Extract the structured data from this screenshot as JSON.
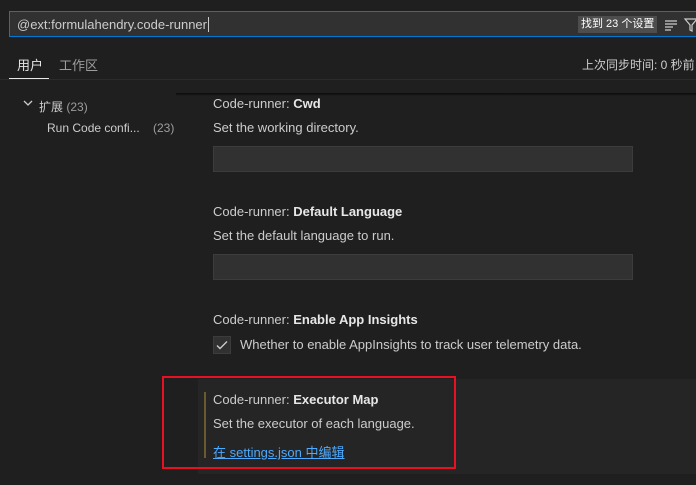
{
  "search": {
    "query": "@ext:formulahendry.code-runner",
    "found_badge": "找到 23 个设置"
  },
  "tabs": {
    "user": "用户",
    "workspace": "工作区",
    "sync_status": "上次同步时间: 0 秒前"
  },
  "toc": {
    "group_label": "扩展",
    "group_count": "(23)",
    "item_label": "Run Code confi...",
    "item_count": "(23)"
  },
  "settings": [
    {
      "category": "Code-runner: ",
      "name": "Cwd",
      "description": "Set the working directory.",
      "value": ""
    },
    {
      "category": "Code-runner: ",
      "name": "Default Language",
      "description": "Set the default language to run.",
      "value": ""
    },
    {
      "category": "Code-runner: ",
      "name": "Enable App Insights",
      "checkbox_label": "Whether to enable AppInsights to track user telemetry data.",
      "checked": true
    },
    {
      "category": "Code-runner: ",
      "name": "Executor Map",
      "description": "Set the executor of each language.",
      "link": "在 settings.json 中编辑"
    }
  ],
  "icons": {
    "filter": "filter-lines-icon",
    "funnel": "funnel-icon",
    "chevron": "chevron-down-icon",
    "check": "check-icon"
  },
  "colors": {
    "focus_border": "#0078d4",
    "link": "#4daafc",
    "highlight": "#e81123"
  }
}
